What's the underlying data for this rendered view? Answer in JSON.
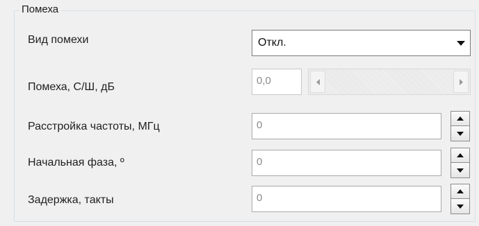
{
  "group": {
    "title": "Помеха"
  },
  "rows": {
    "noise_type": {
      "label": "Вид помехи",
      "value": "Откл."
    },
    "snr": {
      "label": "Помеха, С/Ш, дБ",
      "value": "0,0"
    },
    "freq_offset": {
      "label": "Расстройка частоты, МГц",
      "value": "0"
    },
    "initial_phase": {
      "label": "Начальная фаза, º",
      "value": "0"
    },
    "delay": {
      "label": "Задержка, такты",
      "value": "0"
    }
  },
  "icons": {
    "dropdown": "chevron-down-icon",
    "scroll_left": "arrow-left-icon",
    "scroll_right": "arrow-right-icon",
    "spin_up": "arrow-up-icon",
    "spin_down": "arrow-down-icon"
  }
}
